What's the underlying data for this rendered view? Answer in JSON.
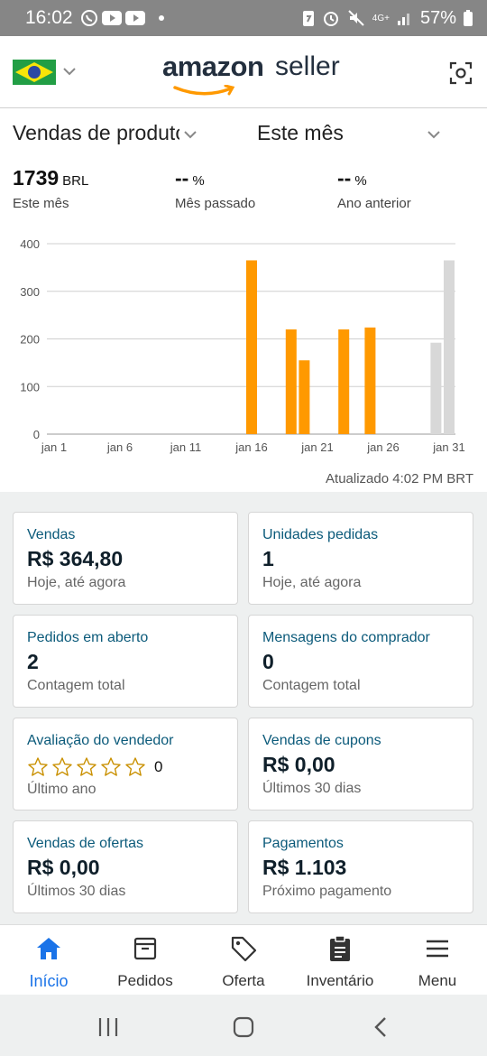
{
  "status_bar": {
    "time": "16:02",
    "battery": "57%",
    "network": "4G+",
    "icons": [
      "whatsapp-icon",
      "youtube-icon",
      "youtube-icon",
      "dot-icon",
      "battery-saver-icon",
      "alarm-icon",
      "mute-icon",
      "signal-icon",
      "battery-icon"
    ]
  },
  "header": {
    "flag": "brazil-flag",
    "brand_word1": "amazon",
    "brand_word2": "seller",
    "scan_icon": "scan-icon"
  },
  "filters": {
    "metric_select": "Vendas de produtos",
    "period_select": "Este mês"
  },
  "summary": [
    {
      "value": "1739",
      "unit": "BRL",
      "label": "Este mês"
    },
    {
      "value": "--",
      "unit": "%",
      "label": "Mês passado"
    },
    {
      "value": "--",
      "unit": "%",
      "label": "Ano anterior"
    }
  ],
  "chart_data": {
    "type": "bar",
    "y_ticks": [
      "0",
      "100",
      "200",
      "300",
      "400"
    ],
    "ylim": [
      0,
      400
    ],
    "x_ticks": [
      "jan 1",
      "jan 6",
      "jan 11",
      "jan 16",
      "jan 21",
      "jan 26",
      "jan 31"
    ],
    "series": [
      {
        "color": "#ff9900",
        "points": [
          {
            "day": 16,
            "value": 365
          },
          {
            "day": 19,
            "value": 220
          },
          {
            "day": 20,
            "value": 155
          },
          {
            "day": 23,
            "value": 220
          },
          {
            "day": 25,
            "value": 224
          }
        ]
      },
      {
        "color": "#d8d8d8",
        "points": [
          {
            "day": 30,
            "value": 192
          },
          {
            "day": 31,
            "value": 365
          }
        ]
      }
    ],
    "grid": true
  },
  "updated": "Atualizado 4:02 PM BRT",
  "cards": [
    {
      "title": "Vendas",
      "value": "R$ 364,80",
      "sub": "Hoje, até agora"
    },
    {
      "title": "Unidades pedidas",
      "value": "1",
      "sub": "Hoje, até agora"
    },
    {
      "title": "Pedidos em aberto",
      "value": "2",
      "sub": "Contagem total"
    },
    {
      "title": "Mensagens do comprador",
      "value": "0",
      "sub": "Contagem total"
    },
    {
      "title": "Avaliação do vendedor",
      "stars_filled": 0,
      "stars_total": 5,
      "rating_count": "0",
      "sub": "Último ano"
    },
    {
      "title": "Vendas de cupons",
      "value": "R$ 0,00",
      "sub": "Últimos 30 dias"
    },
    {
      "title": "Vendas de ofertas",
      "value": "R$ 0,00",
      "sub": "Últimos 30 dias"
    },
    {
      "title": "Pagamentos",
      "value": "R$ 1.103",
      "sub": "Próximo pagamento"
    }
  ],
  "nav": [
    {
      "label": "Início",
      "icon": "home-icon",
      "active": true
    },
    {
      "label": "Pedidos",
      "icon": "orders-box-icon"
    },
    {
      "label": "Oferta",
      "icon": "tag-icon"
    },
    {
      "label": "Inventário",
      "icon": "clipboard-icon"
    },
    {
      "label": "Menu",
      "icon": "hamburger-icon"
    }
  ],
  "colors": {
    "accent": "#ff9900",
    "link": "#0b5a7a",
    "active_nav": "#1a73e8"
  }
}
